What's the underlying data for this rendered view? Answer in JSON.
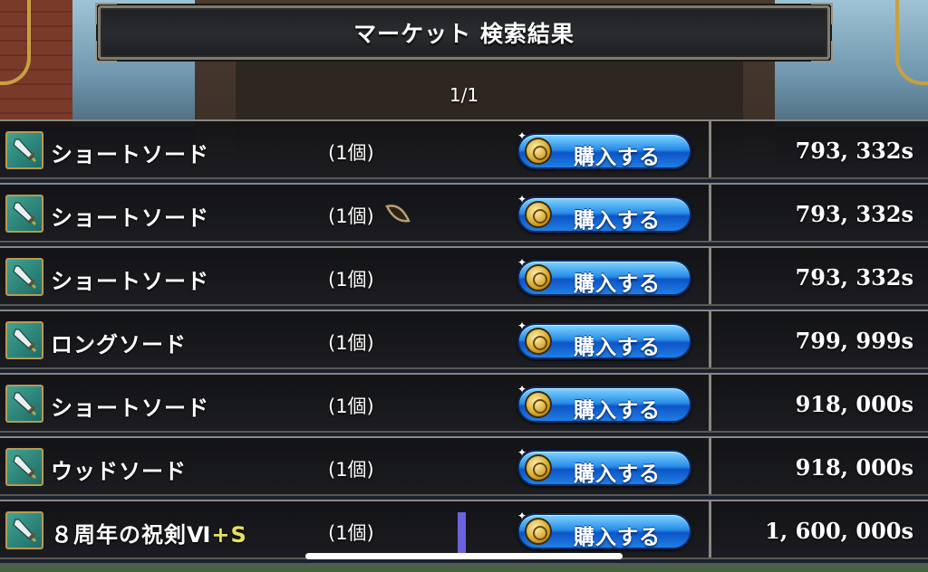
{
  "header": {
    "title": "マーケット 検索結果",
    "page_indicator": "1/1"
  },
  "colors": {
    "button_blue": "#2a8ee8",
    "enhancement_yellow": "#e6e060",
    "icon_teal": "#3fa393"
  },
  "listings": [
    {
      "name": "ショートソード",
      "enhancement": "",
      "quantity": "(1個)",
      "button_label": "購入する",
      "price": "793, 332s",
      "icon": "sword-icon"
    },
    {
      "name": "ショートソード",
      "enhancement": "",
      "quantity": "(1個)",
      "button_label": "購入する",
      "price": "793, 332s",
      "icon": "sword-icon"
    },
    {
      "name": "ショートソード",
      "enhancement": "",
      "quantity": "(1個)",
      "button_label": "購入する",
      "price": "793, 332s",
      "icon": "sword-icon"
    },
    {
      "name": "ロングソード",
      "enhancement": "",
      "quantity": "(1個)",
      "button_label": "購入する",
      "price": "799, 999s",
      "icon": "sword-icon"
    },
    {
      "name": "ショートソード",
      "enhancement": "",
      "quantity": "(1個)",
      "button_label": "購入する",
      "price": "918, 000s",
      "icon": "sword-icon"
    },
    {
      "name": "ウッドソード",
      "enhancement": "",
      "quantity": "(1個)",
      "button_label": "購入する",
      "price": "918, 000s",
      "icon": "sword-icon"
    },
    {
      "name": "８周年の祝剣Ⅵ",
      "enhancement": "+S",
      "quantity": "(1個)",
      "button_label": "購入する",
      "price": "1, 600, 000s",
      "icon": "sword-icon"
    }
  ]
}
